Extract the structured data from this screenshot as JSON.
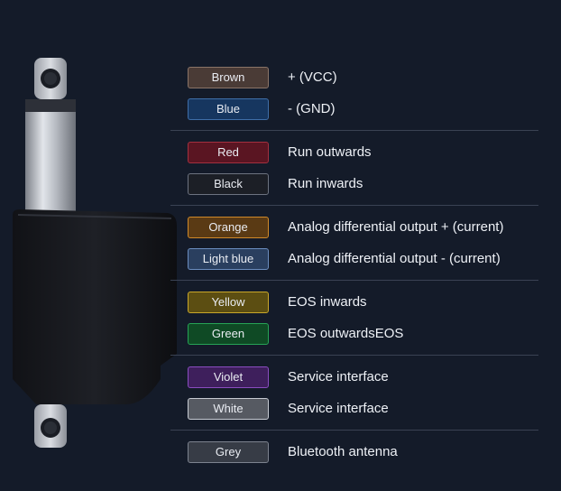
{
  "groups": [
    [
      {
        "color": "Brown",
        "desc": "+ (VCC)",
        "fill": "#4a3b36",
        "border": "#8a7468"
      },
      {
        "color": "Blue",
        "desc": "- (GND)",
        "fill": "#16365f",
        "border": "#3f6ea8"
      }
    ],
    [
      {
        "color": "Red",
        "desc": "Run outwards",
        "fill": "#5a1522",
        "border": "#a3303f"
      },
      {
        "color": "Black",
        "desc": "Run inwards",
        "fill": "#1c1f26",
        "border": "#6d7380"
      }
    ],
    [
      {
        "color": "Orange",
        "desc": "Analog differential output + (current)",
        "fill": "#5a3a14",
        "border": "#d08a2a"
      },
      {
        "color": "Light blue",
        "desc": "Analog differential output - (current)",
        "fill": "#2a3f5f",
        "border": "#6b8dbf"
      }
    ],
    [
      {
        "color": "Yellow",
        "desc": "EOS inwards",
        "fill": "#5c4e12",
        "border": "#c9a72a"
      },
      {
        "color": "Green",
        "desc": "EOS outwardsEOS",
        "fill": "#0f4a25",
        "border": "#27a356"
      }
    ],
    [
      {
        "color": "Violet",
        "desc": "Service interface",
        "fill": "#3e1f5c",
        "border": "#8a4dc0"
      },
      {
        "color": "White",
        "desc": "Service interface",
        "fill": "#565a62",
        "border": "#c7cbd3"
      }
    ],
    [
      {
        "color": "Grey",
        "desc": "Bluetooth antenna",
        "fill": "#373c46",
        "border": "#7d838f"
      }
    ]
  ],
  "device_icon": "linear-actuator-image"
}
